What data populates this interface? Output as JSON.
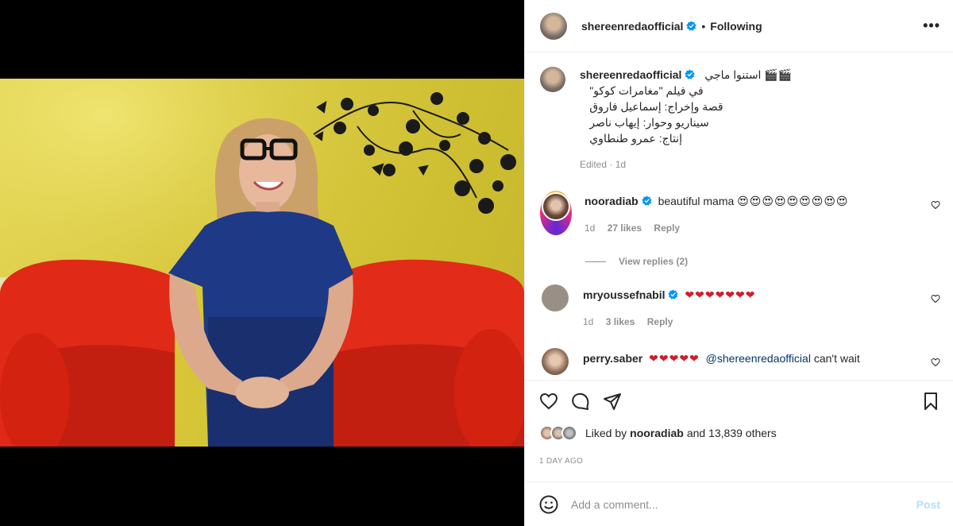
{
  "post": {
    "author": "shereenredaofficial",
    "follow_state": "Following",
    "dot": "•",
    "more": "•••",
    "caption_username": "shereenredaofficial",
    "caption_lines": [
      "استنوا ماجي 🎬🎬",
      "في فيلم \"مغامرات كوكو\"",
      "قصة وإخراج: إسماعيل فاروق",
      "سيناريو وحوار: إيهاب ناصر",
      "إنتاج: عمرو طنطاوي"
    ],
    "caption_meta": "Edited · 1d"
  },
  "comments": [
    {
      "user": "nooradiab",
      "text": "beautiful mama",
      "emoji": "😍😍😍😍😍😍😍😍😍",
      "age": "1d",
      "likes": "27 likes",
      "reply": "Reply",
      "view_replies": "View replies (2)"
    },
    {
      "user": "mryoussefnabil",
      "text": "",
      "emoji": "❤❤❤❤❤❤❤",
      "age": "1d",
      "likes": "3 likes",
      "reply": "Reply"
    },
    {
      "user": "perry.saber",
      "emoji": "❤❤❤❤❤",
      "mention": "@shereenredaofficial",
      "text": "can't wait"
    }
  ],
  "likes": {
    "prefix": "Liked by",
    "user": "nooradiab",
    "suffix": "and 13,839 others"
  },
  "date": "1 DAY AGO",
  "add_comment": {
    "placeholder": "Add a comment...",
    "post_label": "Post"
  },
  "colors": {
    "verified": "#0095f6",
    "heart": "#d21b2b",
    "post_disabled": "#b2dffc",
    "muted": "#8e8e8e"
  }
}
